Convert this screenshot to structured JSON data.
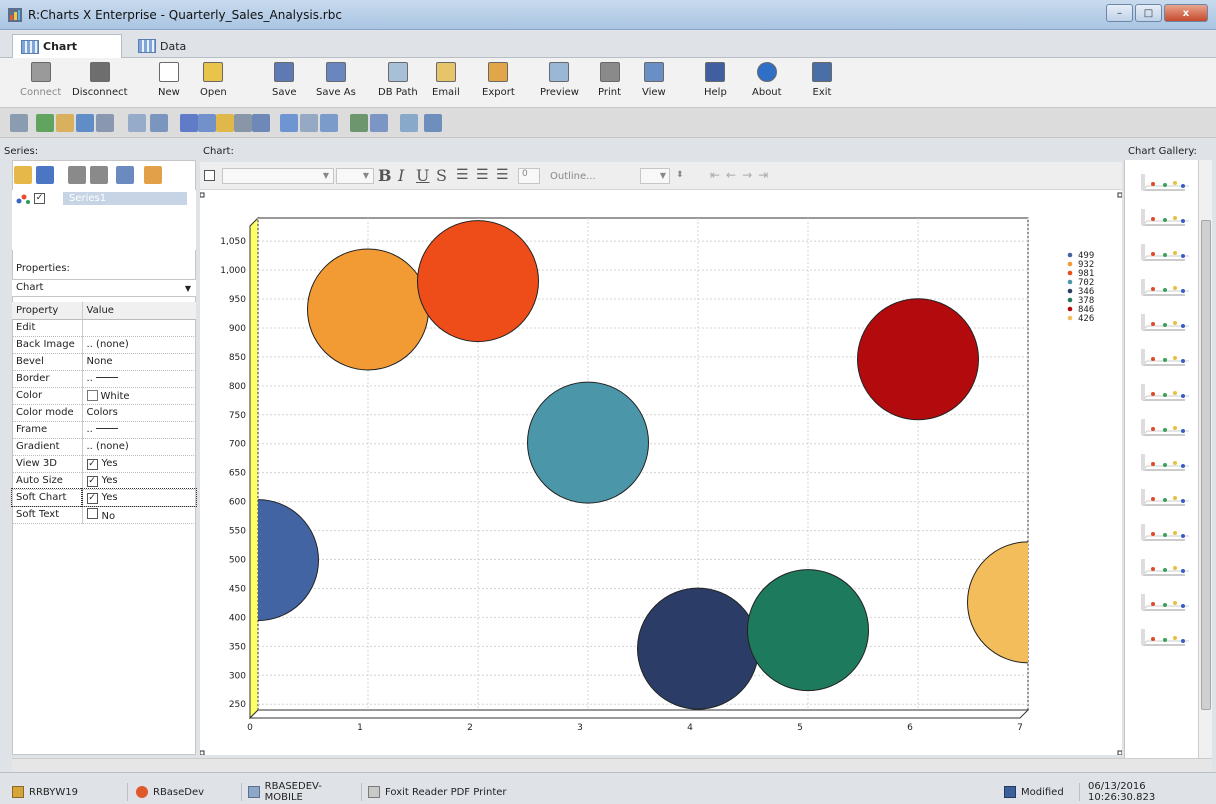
{
  "window": {
    "title": "R:Charts X Enterprise - Quarterly_Sales_Analysis.rbc",
    "buttons": {
      "minimize": "–",
      "maximize": "□",
      "close": "x"
    }
  },
  "tabs": [
    {
      "label": "Chart",
      "active": true
    },
    {
      "label": "Data",
      "active": false
    }
  ],
  "toolbar": [
    {
      "label": "Connect",
      "enabled": false,
      "icon": "plug-icon"
    },
    {
      "label": "Disconnect",
      "enabled": true,
      "icon": "disconnect-icon"
    },
    {
      "label": "New",
      "enabled": true,
      "icon": "new-document-icon"
    },
    {
      "label": "Open",
      "enabled": true,
      "icon": "folder-icon"
    },
    {
      "label": "Save",
      "enabled": true,
      "icon": "floppy-icon"
    },
    {
      "label": "Save As",
      "enabled": true,
      "icon": "save-as-icon"
    },
    {
      "label": "DB Path",
      "enabled": true,
      "icon": "db-path-icon"
    },
    {
      "label": "Email",
      "enabled": true,
      "icon": "email-icon"
    },
    {
      "label": "Export",
      "enabled": true,
      "icon": "export-icon"
    },
    {
      "label": "Preview",
      "enabled": true,
      "icon": "preview-icon"
    },
    {
      "label": "Print",
      "enabled": true,
      "icon": "printer-icon"
    },
    {
      "label": "View",
      "enabled": true,
      "icon": "view-icon"
    },
    {
      "label": "Help",
      "enabled": true,
      "icon": "help-book-icon"
    },
    {
      "label": "About",
      "enabled": true,
      "icon": "info-icon"
    },
    {
      "label": "Exit",
      "enabled": true,
      "icon": "exit-door-icon"
    }
  ],
  "panels": {
    "series_label": "Series:",
    "chart_label": "Chart:",
    "gallery_label": "Chart Gallery:",
    "properties_label": "Properties:"
  },
  "series": [
    {
      "name": "Series1",
      "checked": true
    }
  ],
  "properties": {
    "selector": "Chart",
    "header": {
      "key": "Property",
      "value": "Value"
    },
    "rows": [
      {
        "key": "Edit",
        "value": ""
      },
      {
        "key": "Back Image",
        "value": ".. (none)"
      },
      {
        "key": "Bevel",
        "value": "None"
      },
      {
        "key": "Border",
        "value": "..",
        "line": true
      },
      {
        "key": "Color",
        "value": "White",
        "swatch": "#ffffff"
      },
      {
        "key": "Color mode",
        "value": "Colors"
      },
      {
        "key": "Frame",
        "value": "..",
        "line": true
      },
      {
        "key": "Gradient",
        "value": ".. (none)"
      },
      {
        "key": "View 3D",
        "value": "Yes",
        "checkbox": true
      },
      {
        "key": "Auto Size",
        "value": "Yes",
        "checkbox": true
      },
      {
        "key": "Soft Chart",
        "value": "Yes",
        "checkbox": true
      },
      {
        "key": "Soft Text",
        "value": "No",
        "checkbox": false
      }
    ]
  },
  "chart_format": {
    "outline_label": "Outline...",
    "spin_value": "0"
  },
  "chart_data": {
    "type": "scatter",
    "subtype": "bubble",
    "xlim": [
      0,
      7
    ],
    "ylim": [
      240,
      1090
    ],
    "xticks": [
      0,
      1,
      2,
      3,
      4,
      5,
      6,
      7
    ],
    "yticks": [
      250,
      300,
      350,
      400,
      450,
      500,
      550,
      600,
      650,
      700,
      750,
      800,
      850,
      900,
      950,
      "1,000",
      "1,050"
    ],
    "points": [
      {
        "x": 0,
        "y": 499,
        "r": 110,
        "color": "#4364a2",
        "label": "499"
      },
      {
        "x": 1,
        "y": 932,
        "r": 110,
        "color": "#f29a33",
        "label": "932"
      },
      {
        "x": 2,
        "y": 981,
        "r": 110,
        "color": "#ee4d19",
        "label": "981"
      },
      {
        "x": 3,
        "y": 702,
        "r": 110,
        "color": "#4b96a8",
        "label": "702"
      },
      {
        "x": 4,
        "y": 346,
        "r": 110,
        "color": "#2b3d66",
        "label": "346"
      },
      {
        "x": 5,
        "y": 378,
        "r": 110,
        "color": "#1e7a5c",
        "label": "378"
      },
      {
        "x": 6,
        "y": 846,
        "r": 110,
        "color": "#b20a0d",
        "label": "846"
      },
      {
        "x": 7,
        "y": 426,
        "r": 110,
        "color": "#f2bd5a",
        "label": "426"
      }
    ],
    "legend": [
      "499",
      "932",
      "981",
      "702",
      "346",
      "378",
      "846",
      "426"
    ],
    "legend_position": "right",
    "grid": true,
    "view3d": true,
    "wall_color": "#ffff66"
  },
  "statusbar": {
    "items": [
      "RRBYW19",
      "RBaseDev",
      "RBASEDEV-MOBILE",
      "Foxit Reader PDF Printer"
    ],
    "state": "Modified",
    "datetime": "06/13/2016 10:26:30.823"
  }
}
